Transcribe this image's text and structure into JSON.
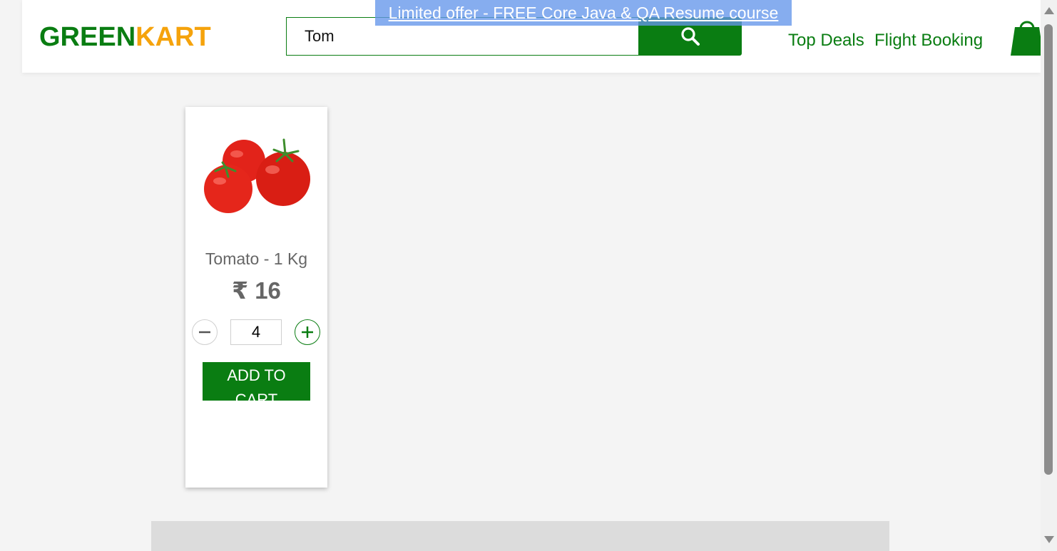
{
  "header": {
    "brand_part1": "GREEN",
    "brand_part2": "KART",
    "search": {
      "value": "Tom",
      "icon": "search-icon"
    },
    "offer_banner": "Limited offer - FREE Core Java & QA Resume course",
    "nav": [
      {
        "label": "Top Deals"
      },
      {
        "label": "Flight Booking"
      }
    ],
    "cart_icon": "shopping-bag-icon"
  },
  "products": [
    {
      "name": "Tomato - 1 Kg",
      "price": "₹ 16",
      "quantity": "4",
      "add_button": "ADD TO CART",
      "image_icon": "tomato-image"
    }
  ],
  "colors": {
    "brand_green": "#0a7d12",
    "brand_orange": "#f5a30c",
    "banner_blue": "#6496eb",
    "page_bg": "#f4f4f4"
  }
}
